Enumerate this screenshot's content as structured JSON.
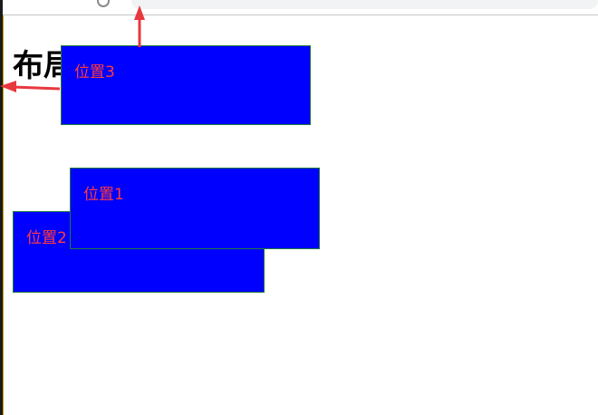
{
  "page": {
    "heading": "布局"
  },
  "boxes": [
    {
      "id": "box-3",
      "label": "位置3"
    },
    {
      "id": "box-1",
      "label": "位置1"
    },
    {
      "id": "box-2",
      "label": "位置2"
    }
  ],
  "colors": {
    "box_fill": "#0000ff",
    "box_border": "#1f7a3a",
    "label_text": "#ff3b3b",
    "arrow": "#e8383d"
  },
  "icons": {
    "up_arrow": "arrow-up-icon",
    "left_arrow": "arrow-left-icon"
  }
}
